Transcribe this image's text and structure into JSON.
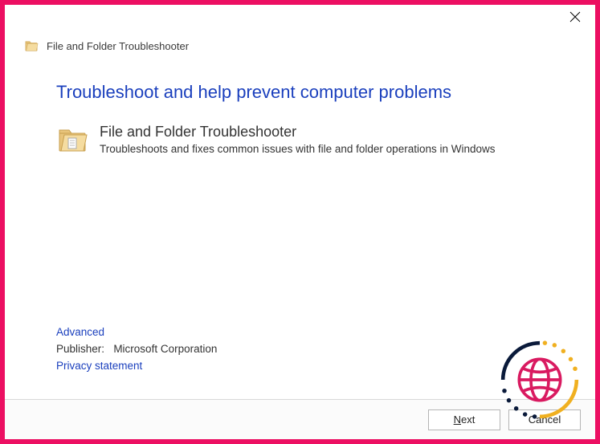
{
  "window": {
    "header_text": "File and Folder Troubleshooter"
  },
  "content": {
    "main_title": "Troubleshoot and help prevent computer problems",
    "item_title": "File and Folder Troubleshooter",
    "item_desc": "Troubleshoots and fixes common issues with file and folder operations in Windows"
  },
  "links": {
    "advanced": "Advanced",
    "privacy": "Privacy statement"
  },
  "publisher": {
    "label": "Publisher:",
    "value": "Microsoft Corporation"
  },
  "buttons": {
    "next_prefix": "N",
    "next_suffix": "ext",
    "cancel": "Cancel"
  }
}
